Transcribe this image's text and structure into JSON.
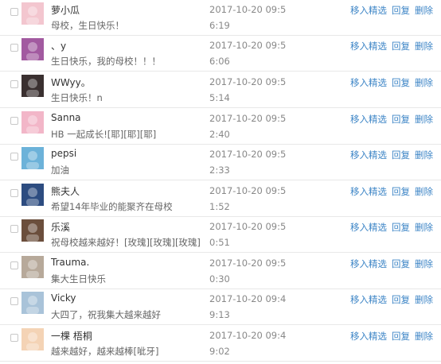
{
  "actions": {
    "pick": "移入精选",
    "reply": "回复",
    "delete": "删除"
  },
  "comments": [
    {
      "name": "萝小瓜",
      "text": "母校，生日快乐！",
      "date": "2017-10-20 09:5",
      "time": "6:19",
      "avatar_color": "#f3c6cf"
    },
    {
      "name": "、y",
      "text": "生日快乐，我的母校！！！",
      "date": "2017-10-20 09:5",
      "time": "6:06",
      "avatar_color": "#a25aa0"
    },
    {
      "name": "WWyy。",
      "text": "生日快乐！n",
      "date": "2017-10-20 09:5",
      "time": "5:14",
      "avatar_color": "#3a3030"
    },
    {
      "name": "Sanna",
      "text": "HB 一起成长![耶][耶][耶]",
      "date": "2017-10-20 09:5",
      "time": "2:40",
      "avatar_color": "#f2b6c8"
    },
    {
      "name": "pepsi",
      "text": "加油",
      "date": "2017-10-20 09:5",
      "time": "2:33",
      "avatar_color": "#6cb2d9"
    },
    {
      "name": "熊夫人",
      "text": "希望14年毕业的能聚齐在母校",
      "date": "2017-10-20 09:5",
      "time": "1:52",
      "avatar_color": "#2d4c80"
    },
    {
      "name": "乐溪",
      "text": "祝母校越来越好！[玫瑰][玫瑰][玫瑰]",
      "date": "2017-10-20 09:5",
      "time": "0:51",
      "avatar_color": "#6b4e3c"
    },
    {
      "name": "Trauma.",
      "text": "集大生日快乐",
      "date": "2017-10-20 09:5",
      "time": "0:30",
      "avatar_color": "#b7a99a"
    },
    {
      "name": "Vicky",
      "text": "大四了，祝我集大越来越好",
      "date": "2017-10-20 09:4",
      "time": "9:13",
      "avatar_color": "#a9c3d9"
    },
    {
      "name": "一棵 梧桐",
      "text": "越来越好，越来越棒[呲牙]",
      "date": "2017-10-20 09:4",
      "time": "9:02",
      "avatar_color": "#f4d3b5"
    }
  ]
}
